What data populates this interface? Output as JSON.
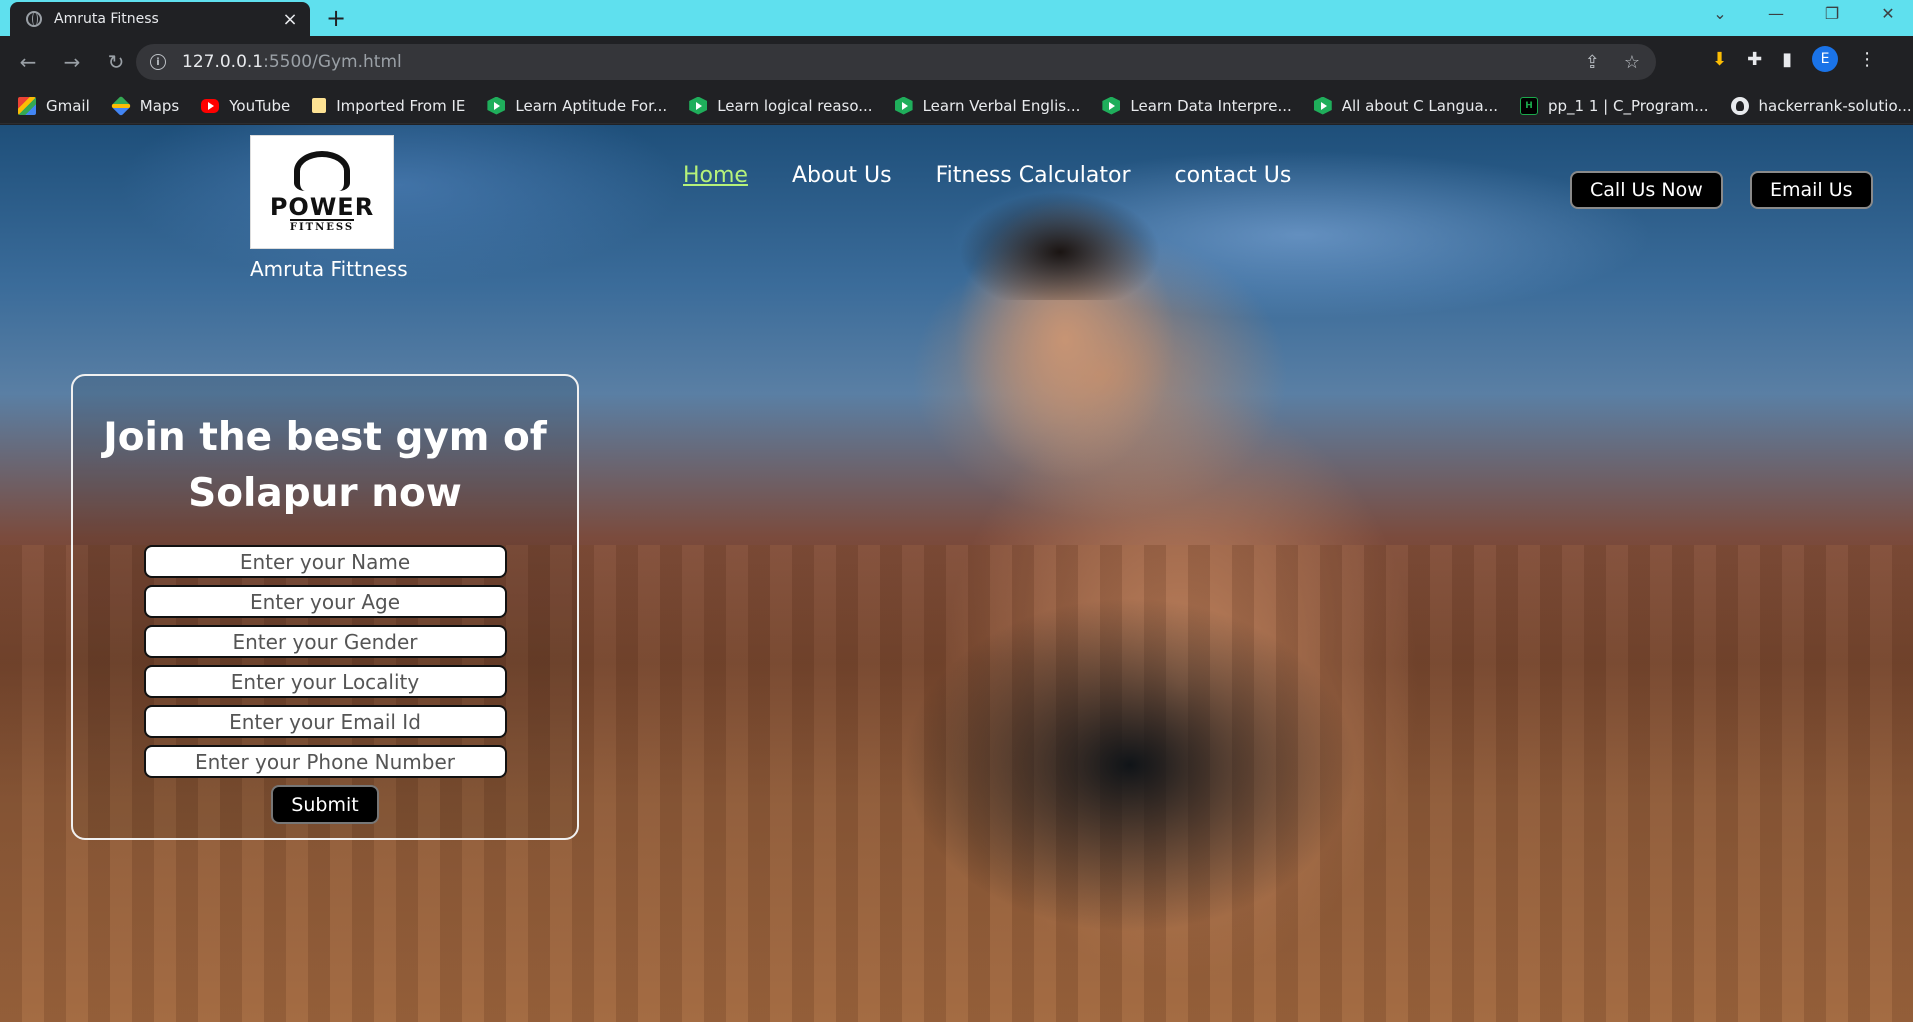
{
  "browser": {
    "tab_title": "Amruta Fitness",
    "tab_close": "×",
    "new_tab": "+",
    "url_host": "127.0.0.1",
    "url_path": ":5500/Gym.html",
    "profile_initial": "E",
    "window_controls": [
      "⌄",
      "—",
      "❐",
      "✕"
    ]
  },
  "bookmarks": [
    {
      "label": "Gmail",
      "icon": "gmail-icon"
    },
    {
      "label": "Maps",
      "icon": "maps-icon"
    },
    {
      "label": "YouTube",
      "icon": "youtube-icon"
    },
    {
      "label": "Imported From IE",
      "icon": "folder-icon"
    },
    {
      "label": "Learn Aptitude For...",
      "icon": "learn-icon"
    },
    {
      "label": "Learn logical reaso...",
      "icon": "learn-icon"
    },
    {
      "label": "Learn Verbal Englis...",
      "icon": "learn-icon"
    },
    {
      "label": "Learn Data Interpre...",
      "icon": "learn-icon"
    },
    {
      "label": "All about C Langua...",
      "icon": "learn-icon"
    },
    {
      "label": "pp_1 1 | C_Program...",
      "icon": "hackerrank-icon"
    },
    {
      "label": "hackerrank-solutio...",
      "icon": "github-icon"
    }
  ],
  "site": {
    "logo_word": "POWER",
    "logo_sub": "FITNESS",
    "brand_name": "Amruta Fittness",
    "nav": [
      {
        "label": "Home",
        "active": true
      },
      {
        "label": "About Us",
        "active": false
      },
      {
        "label": "Fitness Calculator",
        "active": false
      },
      {
        "label": "contact Us",
        "active": false
      }
    ],
    "call_button": "Call Us Now",
    "email_button": "Email Us",
    "accent_color": "#b6f27a"
  },
  "form": {
    "title": "Join the best gym of Solapur now",
    "name_placeholder": "Enter your Name",
    "age_placeholder": "Enter your Age",
    "gender_placeholder": "Enter your Gender",
    "locality_placeholder": "Enter your Locality",
    "email_placeholder": "Enter your Email Id",
    "phone_placeholder": "Enter your Phone Number",
    "submit_label": "Submit"
  }
}
